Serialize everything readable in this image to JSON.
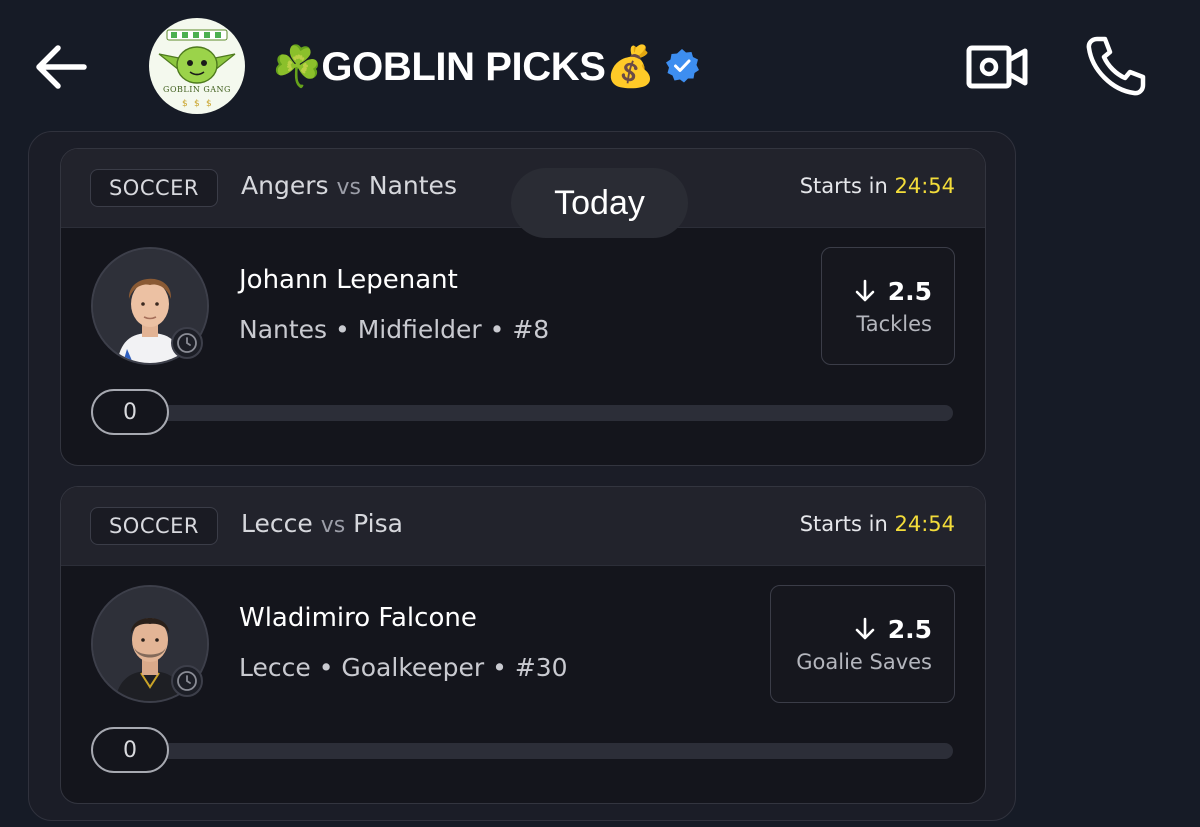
{
  "header": {
    "channel_name": "☘️GOBLIN PICKS💰",
    "avatar_text": "GOBLIN GANG",
    "verified": true,
    "back_icon": "arrow-left-icon",
    "video_icon": "video-camera-icon",
    "phone_icon": "phone-icon"
  },
  "date_separator": "Today",
  "cards": [
    {
      "sport": "SOCCER",
      "home_team": "Angers",
      "vs": "vs",
      "away_team": "Nantes",
      "starts_label": "Starts in",
      "starts_time": "24:54",
      "player_name": "Johann Lepenant",
      "player_info": "Nantes • Midfielder • #8",
      "stat_direction": "under",
      "stat_value": "2.5",
      "stat_label": "Tackles",
      "progress_value": "0"
    },
    {
      "sport": "SOCCER",
      "home_team": "Lecce",
      "vs": "vs",
      "away_team": "Pisa",
      "starts_label": "Starts in",
      "starts_time": "24:54",
      "player_name": "Wladimiro Falcone",
      "player_info": "Lecce • Goalkeeper • #30",
      "stat_direction": "under",
      "stat_value": "2.5",
      "stat_label": "Goalie Saves",
      "progress_value": "0"
    }
  ],
  "colors": {
    "background": "#161b26",
    "card": "#14151c",
    "timer": "#f3dc3a",
    "verified": "#3d8ef0"
  }
}
